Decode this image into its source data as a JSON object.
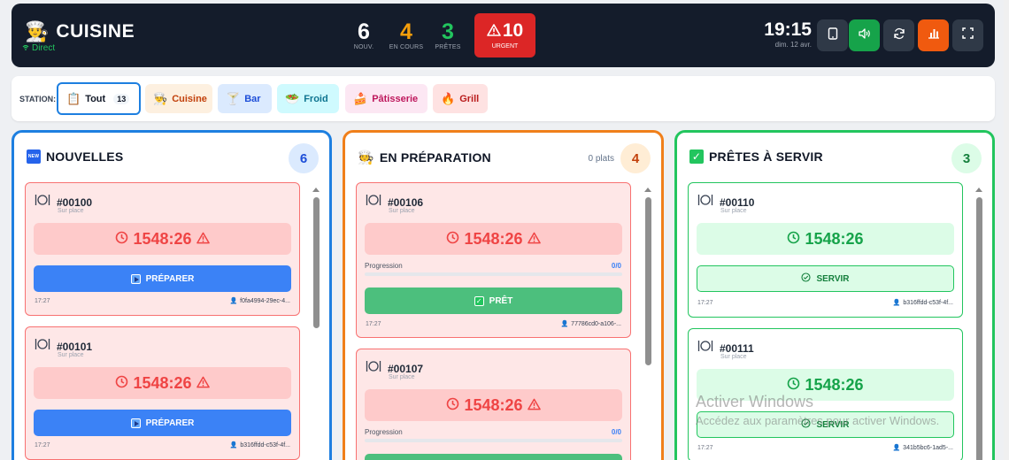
{
  "header": {
    "title": "CUISINE",
    "live": "Direct",
    "stats": [
      {
        "value": "6",
        "label": "NOUV.",
        "color": "#ffffff"
      },
      {
        "value": "4",
        "label": "EN COURS",
        "color": "#f59e0b"
      },
      {
        "value": "3",
        "label": "PRÊTES",
        "color": "#22c55e"
      }
    ],
    "urgent": {
      "value": "10",
      "label": "URGENT"
    },
    "time": "19:15",
    "date": "dim. 12 avr."
  },
  "stations": {
    "label": "STATION:",
    "items": [
      {
        "label": "Tout",
        "count": "13",
        "icon": "clipboard-icon"
      },
      {
        "label": "Cuisine",
        "icon": "chef-icon"
      },
      {
        "label": "Bar",
        "icon": "cocktail-icon"
      },
      {
        "label": "Froid",
        "icon": "salad-icon"
      },
      {
        "label": "Pâtisserie",
        "icon": "cake-icon"
      },
      {
        "label": "Grill",
        "icon": "fire-icon"
      }
    ]
  },
  "columns": {
    "new": {
      "title": "NOUVELLES",
      "count": "6",
      "cards": [
        {
          "id": "#00100",
          "type": "Sur place",
          "timer": "1548:26",
          "button": "PRÉPARER",
          "time": "17:27",
          "owner": "f0fa4994-29ec-4..."
        },
        {
          "id": "#00101",
          "type": "Sur place",
          "timer": "1548:26",
          "button": "PRÉPARER",
          "time": "17:27",
          "owner": "b316ffdd-c53f-4f..."
        }
      ]
    },
    "prep": {
      "title": "EN PRÉPARATION",
      "count": "4",
      "plats": "0 plats",
      "cards": [
        {
          "id": "#00106",
          "type": "Sur place",
          "timer": "1548:26",
          "progress_label": "Progression",
          "progress": "0/0",
          "button": "PRÊT",
          "time": "17:27",
          "owner": "77786cd0-a106-..."
        },
        {
          "id": "#00107",
          "type": "Sur place",
          "timer": "1548:26",
          "progress_label": "Progression",
          "progress": "0/0"
        }
      ]
    },
    "ready": {
      "title": "PRÊTES À SERVIR",
      "count": "3",
      "cards": [
        {
          "id": "#00110",
          "type": "Sur place",
          "timer": "1548:26",
          "button": "SERVIR",
          "time": "17:27",
          "owner": "b316ffdd-c53f-4f..."
        },
        {
          "id": "#00111",
          "type": "Sur place",
          "timer": "1548:26",
          "button": "SERVIR",
          "time": "17:27",
          "owner": "341b5bc6-1ad5-..."
        }
      ]
    }
  },
  "watermark": {
    "title": "Activer Windows",
    "subtitle": "Accédez aux paramètres pour activer Windows."
  },
  "colors": {
    "new": "#1d7fe0",
    "prep": "#f07f1a",
    "ready": "#22c55e",
    "urgent_bg": "#fee2e2",
    "urgent_border": "#f87171",
    "urgent_text": "#ef4444"
  }
}
